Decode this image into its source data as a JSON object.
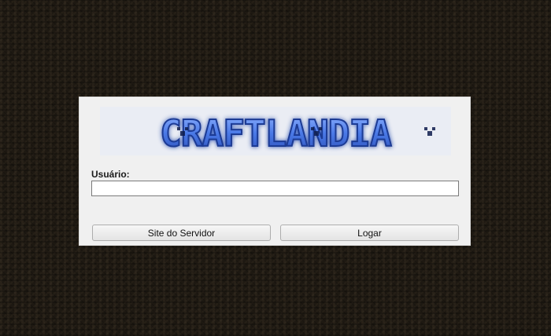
{
  "logo": {
    "text": "CRAFTLANDIA",
    "icon": "minecraft-block-logo",
    "color": "#3f6fe0"
  },
  "login_form": {
    "username_label": "Usuário:",
    "username_value": "",
    "username_placeholder": ""
  },
  "buttons": {
    "site_label": "Site do Servidor",
    "login_label": "Logar"
  }
}
